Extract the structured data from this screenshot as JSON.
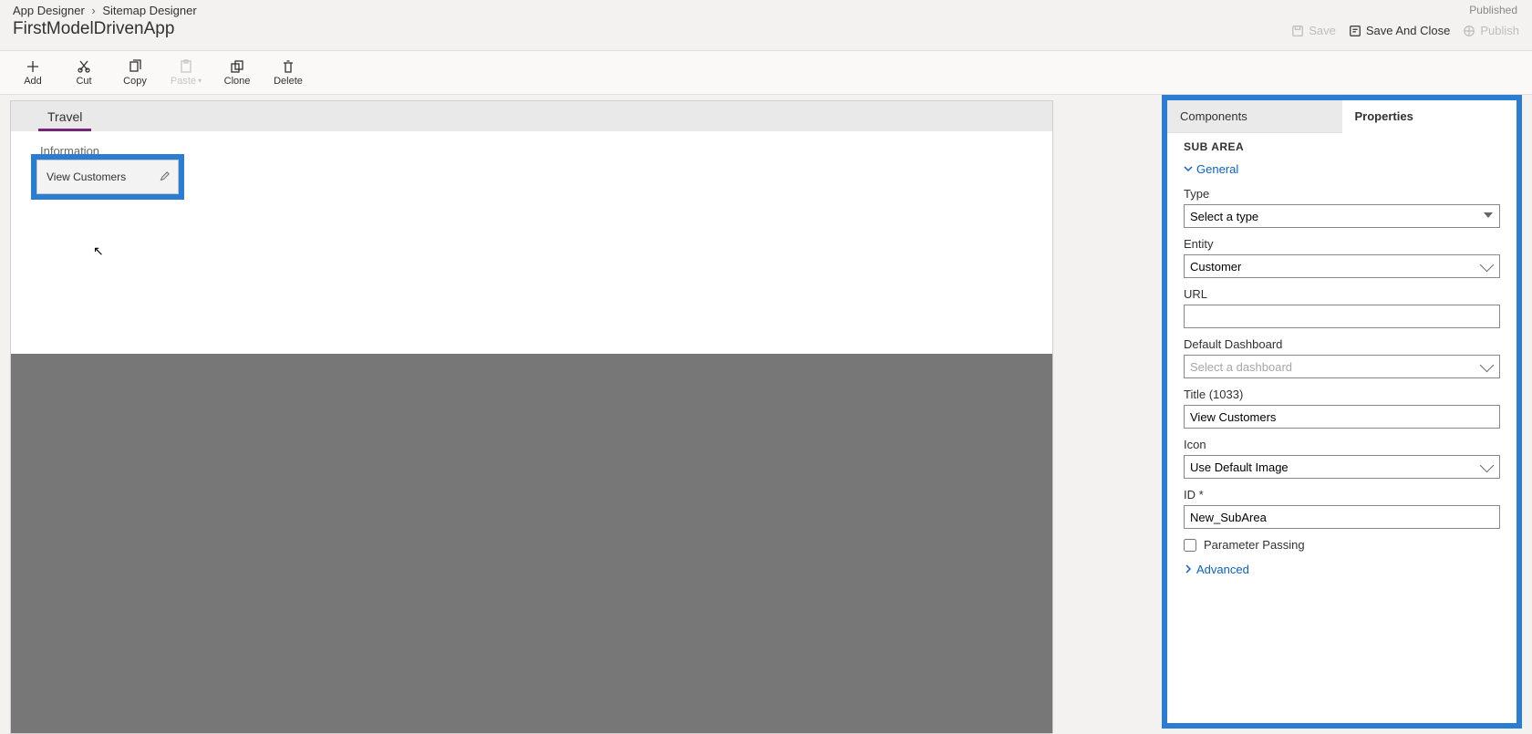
{
  "breadcrumb": {
    "parent": "App Designer",
    "current": "Sitemap Designer"
  },
  "appName": "FirstModelDrivenApp",
  "status": "Published",
  "topActions": {
    "save": "Save",
    "saveClose": "Save And Close",
    "publish": "Publish"
  },
  "toolbar": {
    "add": "Add",
    "cut": "Cut",
    "copy": "Copy",
    "paste": "Paste",
    "clone": "Clone",
    "delete": "Delete"
  },
  "canvas": {
    "areaName": "Travel",
    "groupName": "Information",
    "subareaTile": "View Customers"
  },
  "panel": {
    "tab1": "Components",
    "tab2": "Properties",
    "sectionTitle": "SUB AREA",
    "generalHeader": "General",
    "advancedHeader": "Advanced",
    "fields": {
      "type": {
        "label": "Type",
        "value": "Select a type"
      },
      "entity": {
        "label": "Entity",
        "value": "Customer"
      },
      "url": {
        "label": "URL",
        "value": ""
      },
      "dashboard": {
        "label": "Default Dashboard",
        "placeholder": "Select a dashboard"
      },
      "title": {
        "label": "Title (1033)",
        "value": "View Customers"
      },
      "icon": {
        "label": "Icon",
        "value": "Use Default Image"
      },
      "id": {
        "label": "ID *",
        "value": "New_SubArea"
      },
      "paramPassing": {
        "label": "Parameter Passing"
      }
    }
  }
}
